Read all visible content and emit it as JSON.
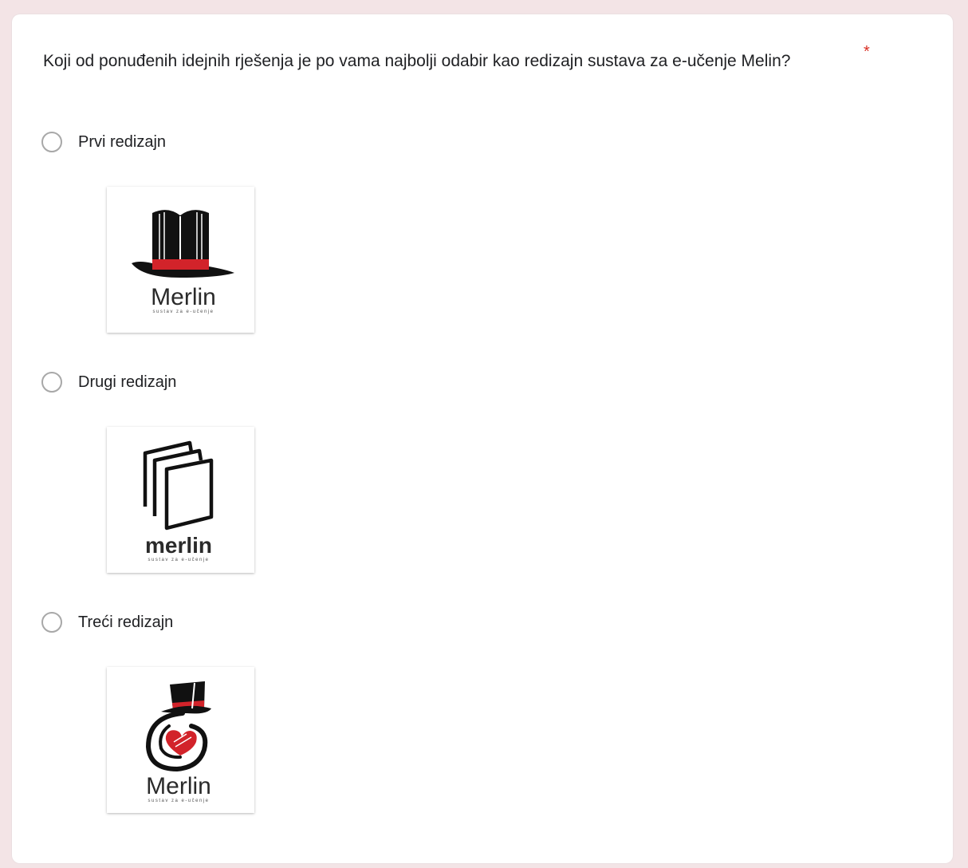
{
  "question": {
    "text": "Koji od ponuđenih idejnih rješenja je po vama najbolji odabir kao redizajn sustava za e-učenje Melin?",
    "required_mark": "*"
  },
  "options": [
    {
      "label": "Prvi redizajn",
      "selected": false
    },
    {
      "label": "Drugi redizajn",
      "selected": false
    },
    {
      "label": "Treći redizajn",
      "selected": false
    }
  ],
  "logos": [
    {
      "wordmark": "Merlin",
      "tagline": "sustav za e-učenje",
      "icon": "book-top-hat-icon"
    },
    {
      "wordmark": "merlin",
      "tagline": "sustav za e-učenje",
      "icon": "stacked-books-icon"
    },
    {
      "wordmark": "Merlin",
      "tagline": "sustav za e-učenje",
      "icon": "heart-top-hat-icon"
    }
  ],
  "colors": {
    "background": "#f3e4e6",
    "card": "#ffffff",
    "required": "#d93025",
    "logo_red": "#d2232a",
    "logo_black": "#111111"
  }
}
